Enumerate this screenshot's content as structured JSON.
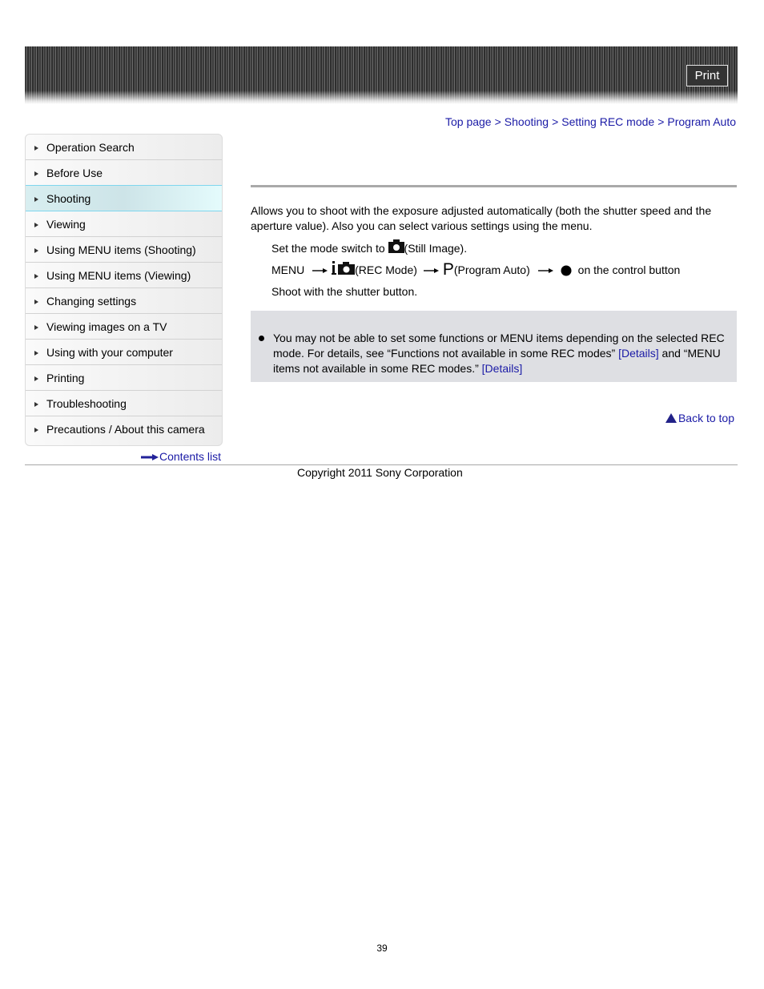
{
  "header": {
    "print_label": "Print"
  },
  "breadcrumb": {
    "items": [
      "Top page",
      "Shooting",
      "Setting REC mode",
      "Program Auto"
    ],
    "separator": ">"
  },
  "sidebar": {
    "items": [
      {
        "label": "Operation Search"
      },
      {
        "label": "Before Use"
      },
      {
        "label": "Shooting",
        "active": true
      },
      {
        "label": "Viewing"
      },
      {
        "label": "Using MENU items (Shooting)"
      },
      {
        "label": "Using MENU items (Viewing)"
      },
      {
        "label": "Changing settings"
      },
      {
        "label": "Viewing images on a TV"
      },
      {
        "label": "Using with your computer"
      },
      {
        "label": "Printing"
      },
      {
        "label": "Troubleshooting"
      },
      {
        "label": "Precautions / About this camera"
      }
    ],
    "contents_link": "Contents list"
  },
  "main": {
    "intro": "Allows you to shoot with the exposure adjusted automatically (both the shutter speed and the aperture value). Also you can select various settings using the menu.",
    "steps": {
      "step1_prefix": "Set the mode switch to",
      "step1_suffix": "(Still Image).",
      "step2_menu": "MENU",
      "step2_rec": "(REC Mode)",
      "step2_p": "P",
      "step2_program": "(Program Auto)",
      "step2_suffix": "on the control button",
      "step3": "Shoot with the shutter button."
    },
    "note": {
      "text1": "You may not be able to set some functions or MENU items depending on the selected REC mode. For details, see “Functions not available in some REC modes” ",
      "link1": "[Details]",
      "text2": " and “MENU items not available in some REC modes.” ",
      "link2": "[Details]"
    },
    "back_to_top": "Back to top"
  },
  "footer": {
    "copyright": "Copyright 2011 Sony Corporation",
    "page_number": "39"
  },
  "colors": {
    "link": "#1a1aa6",
    "active_item_border": "#7fd6ee",
    "note_bg": "#dedfe3"
  }
}
